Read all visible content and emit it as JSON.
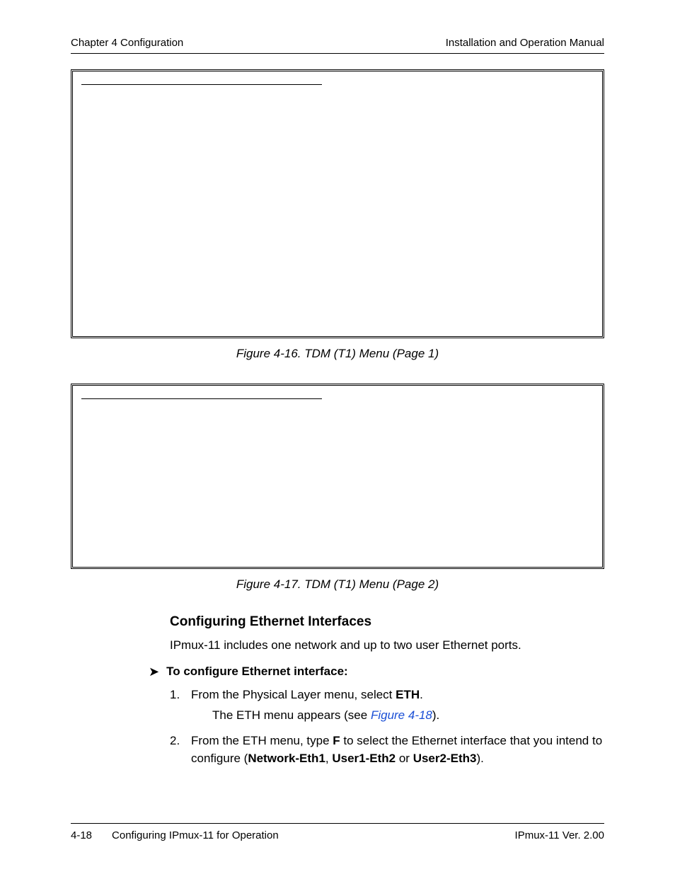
{
  "header": {
    "left": "Chapter 4  Configuration",
    "right": "Installation and Operation Manual"
  },
  "figure16": {
    "caption": "Figure 4-16.  TDM (T1) Menu (Page 1)"
  },
  "figure17": {
    "caption": "Figure 4-17.  TDM (T1) Menu (Page 2)"
  },
  "section": {
    "heading": "Configuring Ethernet Interfaces",
    "intro": "IPmux-11 includes one network and up to two user Ethernet ports.",
    "proc_title": "To configure Ethernet interface:",
    "step1_a": "From the Physical Layer menu, select ",
    "step1_b": "ETH",
    "step1_c": ".",
    "step1_sub_a": "The ETH menu appears (see ",
    "step1_sub_link": "Figure 4-18",
    "step1_sub_b": ").",
    "step2_a": "From the ETH menu, type ",
    "step2_b": "F",
    "step2_c": " to select the Ethernet interface that you intend to configure (",
    "step2_d": "Network-Eth1",
    "step2_e": ", ",
    "step2_f": "User1-Eth2",
    "step2_g": " or ",
    "step2_h": "User2-Eth3",
    "step2_i": ")."
  },
  "footer": {
    "page": "4-18",
    "section": "Configuring IPmux-11 for Operation",
    "product": "IPmux-11 Ver. 2.00"
  }
}
